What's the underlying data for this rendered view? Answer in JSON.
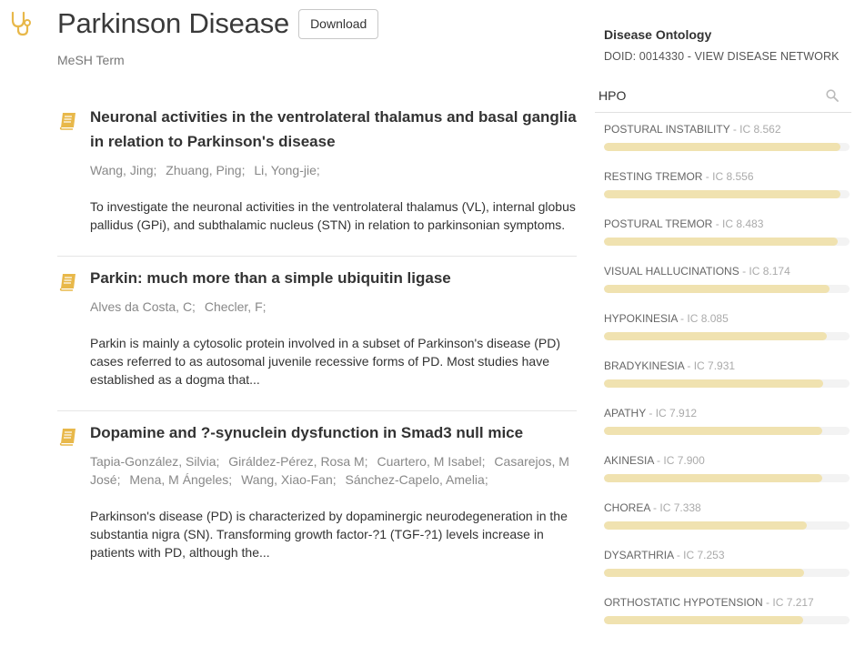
{
  "header": {
    "title": "Parkinson Disease",
    "download_label": "Download",
    "subtitle": "MeSH Term"
  },
  "icons": {
    "app": "stethoscope-icon",
    "article": "book-icon",
    "search": "search-icon"
  },
  "colors": {
    "accent": "#e8b84a",
    "bar_fill": "#f0e2b0",
    "bar_track": "#f3f3f3"
  },
  "articles": [
    {
      "title": "Neuronal activities in the ventrolateral thalamus and basal ganglia in relation to Parkinson's disease",
      "authors": [
        "Wang, Jing;",
        "Zhuang, Ping;",
        "Li, Yong-jie;"
      ],
      "abstract": "To investigate the neuronal activities in the ventrolateral thalamus (VL), internal globus pallidus (GPi), and subthalamic nucleus (STN) in relation to parkinsonian symptoms."
    },
    {
      "title": "Parkin: much more than a simple ubiquitin ligase",
      "authors": [
        "Alves da Costa, C;",
        "Checler, F;"
      ],
      "abstract": "Parkin is mainly a cytosolic protein involved in a subset of Parkinson's disease (PD) cases referred to as autosomal juvenile recessive forms of PD. Most studies have established as a dogma that..."
    },
    {
      "title": "Dopamine and ?-synuclein dysfunction in Smad3 null mice",
      "authors": [
        "Tapia-González, Silvia;",
        "Giráldez-Pérez, Rosa M;",
        "Cuartero, M Isabel;",
        "Casarejos, M José;",
        "Mena, M Ángeles;",
        "Wang, Xiao-Fan;",
        "Sánchez-Capelo, Amelia;"
      ],
      "abstract": "Parkinson's disease (PD) is characterized by dopaminergic neurodegeneration in the substantia nigra (SN). Transforming growth factor-?1 (TGF-?1) levels increase in patients with PD, although the..."
    }
  ],
  "sidebar": {
    "title": "Disease Ontology",
    "doid": "DOID: 0014330 - VIEW DISEASE NETWORK",
    "search": {
      "value": "HPO",
      "placeholder": ""
    },
    "hpo": [
      {
        "term": "POSTURAL INSTABILITY",
        "ic": "- IC 8.562",
        "score": 8.562
      },
      {
        "term": "RESTING TREMOR",
        "ic": "- IC 8.556",
        "score": 8.556
      },
      {
        "term": "POSTURAL TREMOR",
        "ic": "- IC 8.483",
        "score": 8.483
      },
      {
        "term": "VISUAL HALLUCINATIONS",
        "ic": "- IC 8.174",
        "score": 8.174
      },
      {
        "term": "HYPOKINESIA",
        "ic": "- IC 8.085",
        "score": 8.085
      },
      {
        "term": "BRADYKINESIA",
        "ic": "- IC 7.931",
        "score": 7.931
      },
      {
        "term": "APATHY",
        "ic": "- IC 7.912",
        "score": 7.912
      },
      {
        "term": "AKINESIA",
        "ic": "- IC 7.900",
        "score": 7.9
      },
      {
        "term": "CHOREA",
        "ic": "- IC 7.338",
        "score": 7.338
      },
      {
        "term": "DYSARTHRIA",
        "ic": "- IC 7.253",
        "score": 7.253
      },
      {
        "term": "ORTHOSTATIC HYPOTENSION",
        "ic": "- IC 7.217",
        "score": 7.217
      }
    ]
  }
}
